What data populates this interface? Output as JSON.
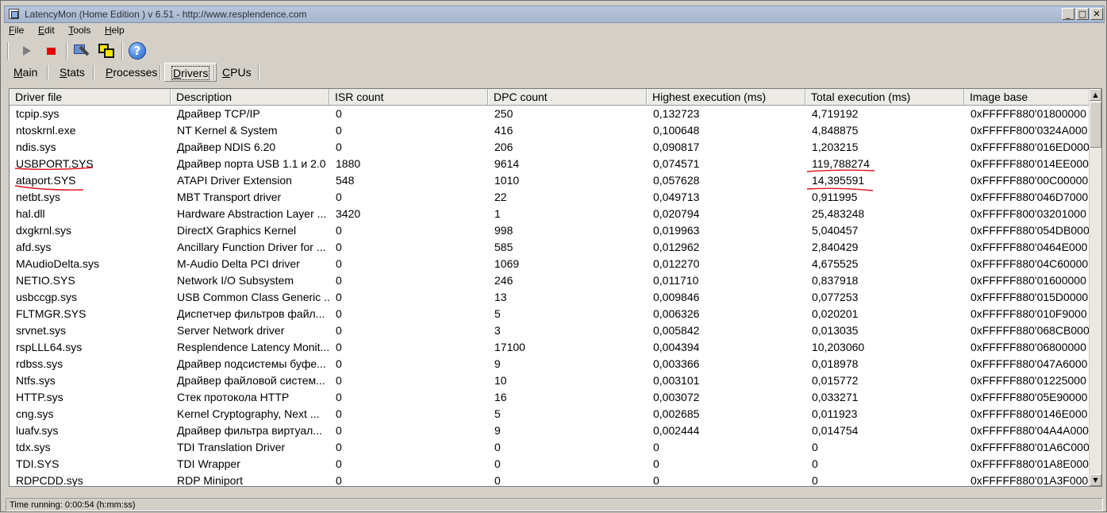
{
  "window": {
    "title": "LatencyMon  (Home Edition )  v 6.51 - http://www.resplendence.com",
    "minimize_glyph": "_",
    "maximize_glyph": "□",
    "close_glyph": "✕"
  },
  "menu": {
    "items": [
      "File",
      "Edit",
      "Tools",
      "Help"
    ]
  },
  "toolbar": {
    "icons": [
      "play-icon",
      "stop-icon",
      "wrench-icon",
      "windows-icon",
      "help-icon"
    ],
    "help_glyph": "?"
  },
  "tabs": {
    "items": [
      "Main",
      "Stats",
      "Processes",
      "Drivers",
      "CPUs"
    ],
    "selected": "Drivers"
  },
  "table": {
    "columns": [
      "Driver file",
      "Description",
      "ISR count",
      "DPC count",
      "Highest execution (ms)",
      "Total execution (ms)",
      "Image base"
    ],
    "rows": [
      [
        "tcpip.sys",
        "Драйвер TCP/IP",
        "0",
        "250",
        "0,132723",
        "4,719192",
        "0xFFFFF880'01800000"
      ],
      [
        "ntoskrnl.exe",
        "NT Kernel & System",
        "0",
        "416",
        "0,100648",
        "4,848875",
        "0xFFFFF800'0324A000"
      ],
      [
        "ndis.sys",
        "Драйвер NDIS 6.20",
        "0",
        "206",
        "0,090817",
        "1,203215",
        "0xFFFFF880'016ED000"
      ],
      [
        "USBPORT.SYS",
        "Драйвер порта USB 1.1 и 2.0",
        "1880",
        "9614",
        "0,074571",
        "119,788274",
        "0xFFFFF880'014EE000"
      ],
      [
        "ataport.SYS",
        "ATAPI Driver Extension",
        "548",
        "1010",
        "0,057628",
        "14,395591",
        "0xFFFFF880'00C00000"
      ],
      [
        "netbt.sys",
        "MBT Transport driver",
        "0",
        "22",
        "0,049713",
        "0,911995",
        "0xFFFFF880'046D7000"
      ],
      [
        "hal.dll",
        "Hardware Abstraction Layer ...",
        "3420",
        "1",
        "0,020794",
        "25,483248",
        "0xFFFFF800'03201000"
      ],
      [
        "dxgkrnl.sys",
        "DirectX Graphics Kernel",
        "0",
        "998",
        "0,019963",
        "5,040457",
        "0xFFFFF880'054DB000"
      ],
      [
        "afd.sys",
        "Ancillary Function Driver for ...",
        "0",
        "585",
        "0,012962",
        "2,840429",
        "0xFFFFF880'0464E000"
      ],
      [
        "MAudioDelta.sys",
        "M-Audio Delta PCI driver",
        "0",
        "1069",
        "0,012270",
        "4,675525",
        "0xFFFFF880'04C60000"
      ],
      [
        "NETIO.SYS",
        "Network I/O Subsystem",
        "0",
        "246",
        "0,011710",
        "0,837918",
        "0xFFFFF880'01600000"
      ],
      [
        "usbccgp.sys",
        "USB Common Class Generic ...",
        "0",
        "13",
        "0,009846",
        "0,077253",
        "0xFFFFF880'015D0000"
      ],
      [
        "FLTMGR.SYS",
        "Диспетчер фильтров файл...",
        "0",
        "5",
        "0,006326",
        "0,020201",
        "0xFFFFF880'010F9000"
      ],
      [
        "srvnet.sys",
        "Server Network driver",
        "0",
        "3",
        "0,005842",
        "0,013035",
        "0xFFFFF880'068CB000"
      ],
      [
        "rspLLL64.sys",
        "Resplendence Latency Monit...",
        "0",
        "17100",
        "0,004394",
        "10,203060",
        "0xFFFFF880'06800000"
      ],
      [
        "rdbss.sys",
        "Драйвер подсистемы буфе...",
        "0",
        "9",
        "0,003366",
        "0,018978",
        "0xFFFFF880'047A6000"
      ],
      [
        "Ntfs.sys",
        "Драйвер файловой систем...",
        "0",
        "10",
        "0,003101",
        "0,015772",
        "0xFFFFF880'01225000"
      ],
      [
        "HTTP.sys",
        "Стек протокола HTTP",
        "0",
        "16",
        "0,003072",
        "0,033271",
        "0xFFFFF880'05E90000"
      ],
      [
        "cng.sys",
        "Kernel Cryptography, Next ...",
        "0",
        "5",
        "0,002685",
        "0,011923",
        "0xFFFFF880'0146E000"
      ],
      [
        "luafv.sys",
        "Драйвер фильтра виртуал...",
        "0",
        "9",
        "0,002444",
        "0,014754",
        "0xFFFFF880'04A4A000"
      ],
      [
        "tdx.sys",
        "TDI Translation Driver",
        "0",
        "0",
        "0",
        "0",
        "0xFFFFF880'01A6C000"
      ],
      [
        "TDI.SYS",
        "TDI Wrapper",
        "0",
        "0",
        "0",
        "0",
        "0xFFFFF880'01A8E000"
      ],
      [
        "RDPCDD.sys",
        "RDP Miniport",
        "0",
        "0",
        "0",
        "0",
        "0xFFFFF880'01A3F000"
      ]
    ],
    "annotation_color": "#e0141e"
  },
  "scrollbar": {
    "up_glyph": "▲",
    "down_glyph": "▼"
  },
  "status": {
    "text": "Time running: 0:00:54  (h:mm:ss)"
  }
}
